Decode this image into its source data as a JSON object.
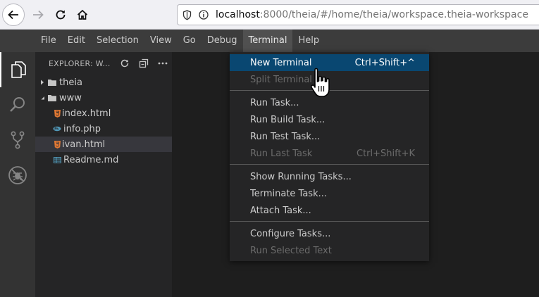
{
  "browser": {
    "url_host": "localhost",
    "url_rest": ":8000/theia/#/home/theia/workspace.theia-workspace"
  },
  "menubar": {
    "items": [
      "File",
      "Edit",
      "Selection",
      "View",
      "Go",
      "Debug",
      "Terminal",
      "Help"
    ],
    "active": "Terminal"
  },
  "sidebar": {
    "title": "EXPLORER: W...",
    "tree": [
      {
        "label": "theia",
        "type": "folder",
        "expanded": false
      },
      {
        "label": "www",
        "type": "folder",
        "expanded": true
      },
      {
        "label": "index.html",
        "type": "html"
      },
      {
        "label": "info.php",
        "type": "php"
      },
      {
        "label": "ivan.html",
        "type": "html",
        "selected": true
      },
      {
        "label": "Readme.md",
        "type": "md"
      }
    ]
  },
  "terminal_menu": {
    "items": [
      {
        "label": "New Terminal",
        "shortcut": "Ctrl+Shift+^",
        "enabled": true,
        "highlighted": true
      },
      {
        "label": "Split Terminal",
        "shortcut": "",
        "enabled": false
      },
      {
        "label": "Run Task...",
        "shortcut": "",
        "enabled": true
      },
      {
        "label": "Run Build Task...",
        "shortcut": "",
        "enabled": true
      },
      {
        "label": "Run Test Task...",
        "shortcut": "",
        "enabled": true
      },
      {
        "label": "Run Last Task",
        "shortcut": "Ctrl+Shift+K",
        "enabled": false
      },
      {
        "label": "Show Running Tasks...",
        "shortcut": "",
        "enabled": true
      },
      {
        "label": "Terminate Task...",
        "shortcut": "",
        "enabled": true
      },
      {
        "label": "Attach Task...",
        "shortcut": "",
        "enabled": true
      },
      {
        "label": "Configure Tasks...",
        "shortcut": "",
        "enabled": true
      },
      {
        "label": "Run Selected Text",
        "shortcut": "",
        "enabled": false
      }
    ]
  },
  "colors": {
    "menu_highlight": "#094771",
    "html_icon": "#e37933",
    "php_icon": "#519aba",
    "md_icon": "#519aba"
  },
  "icons": {
    "back": "arrow-left-icon",
    "forward": "arrow-right-icon",
    "reload": "reload-icon",
    "home": "home-icon",
    "explorer": "files-icon",
    "search": "search-icon",
    "scm": "source-control-icon",
    "debug": "debug-icon"
  }
}
